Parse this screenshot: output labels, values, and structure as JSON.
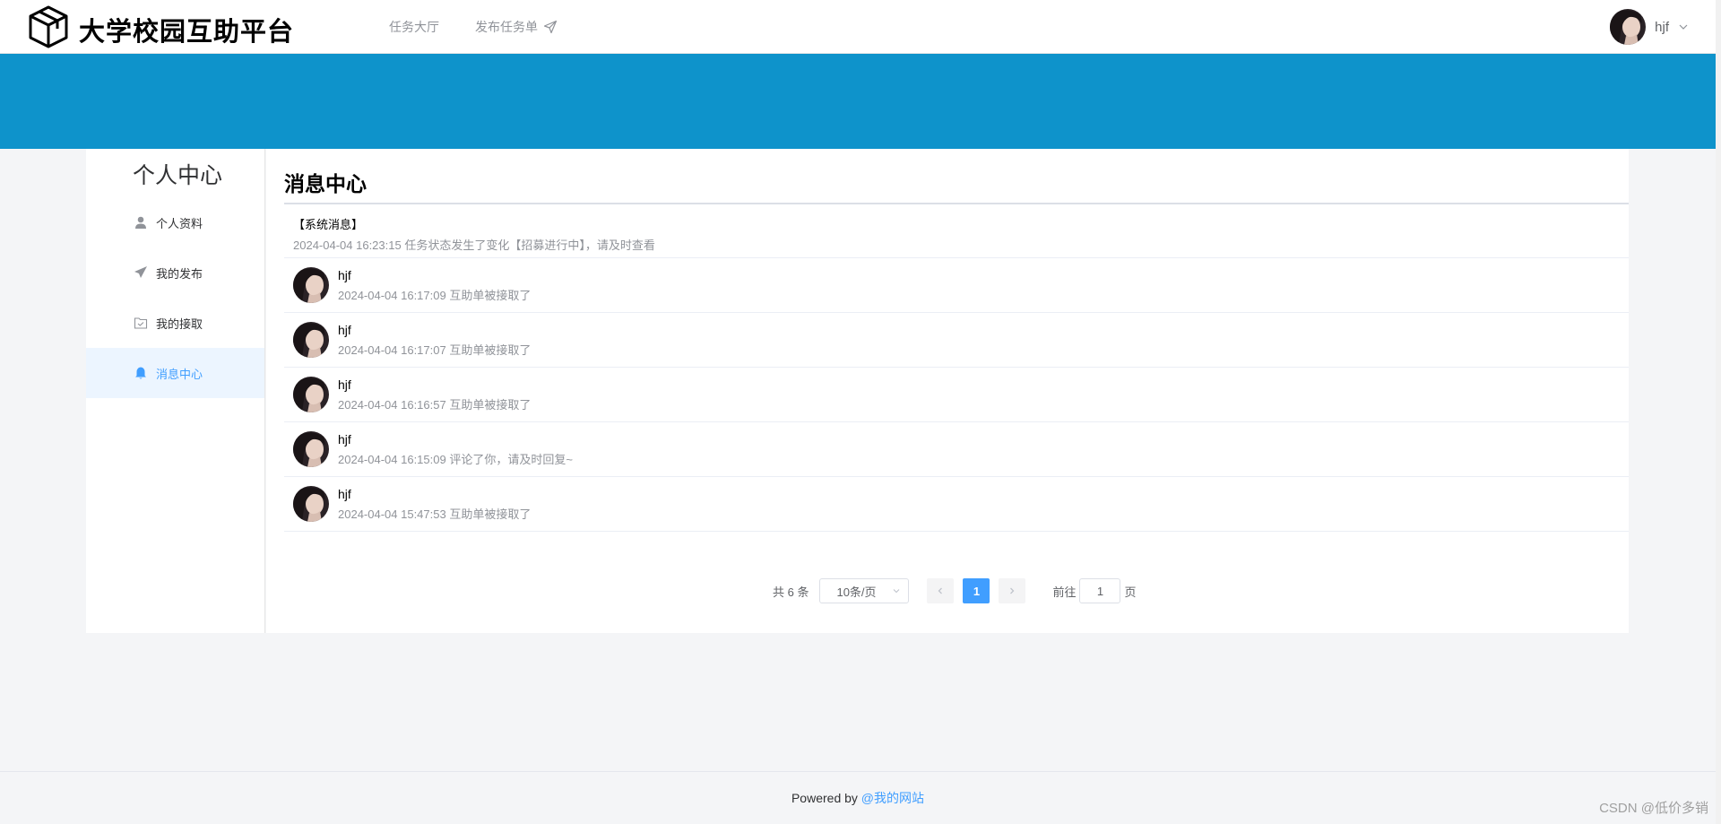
{
  "header": {
    "brand": "大学校园互助平台",
    "nav": [
      {
        "label": "任务大厅"
      },
      {
        "label": "发布任务单"
      }
    ],
    "user_name": "hjf"
  },
  "sidebar": {
    "title": "个人中心",
    "items": [
      {
        "label": "个人资料",
        "icon": "user-icon"
      },
      {
        "label": "我的发布",
        "icon": "send-icon"
      },
      {
        "label": "我的接取",
        "icon": "checked-folder-icon"
      },
      {
        "label": "消息中心",
        "icon": "bell-icon",
        "active": true
      }
    ]
  },
  "main": {
    "title": "消息中心",
    "system_message": {
      "title": "【系统消息】",
      "body": "2024-04-04 16:23:15 任务状态发生了变化【招募进行中】，请及时查看"
    },
    "messages": [
      {
        "name": "hjf",
        "content": "2024-04-04 16:17:09 互助单被接取了"
      },
      {
        "name": "hjf",
        "content": "2024-04-04 16:17:07 互助单被接取了"
      },
      {
        "name": "hjf",
        "content": "2024-04-04 16:16:57 互助单被接取了"
      },
      {
        "name": "hjf",
        "content": "2024-04-04 16:15:09 评论了你，请及时回复~"
      },
      {
        "name": "hjf",
        "content": "2024-04-04 15:47:53 互助单被接取了"
      }
    ]
  },
  "pagination": {
    "total": "共 6 条",
    "page_size": "10条/页",
    "current_page": "1",
    "jump_prefix": "前往",
    "jump_value": "1",
    "jump_suffix": "页"
  },
  "footer": {
    "powered_by": "Powered by ",
    "link": "@我的网站"
  },
  "watermark": "CSDN @低价多销",
  "colors": {
    "banner": "#0e93cb",
    "accent": "#409eff",
    "active_bg": "#ecf5ff"
  }
}
